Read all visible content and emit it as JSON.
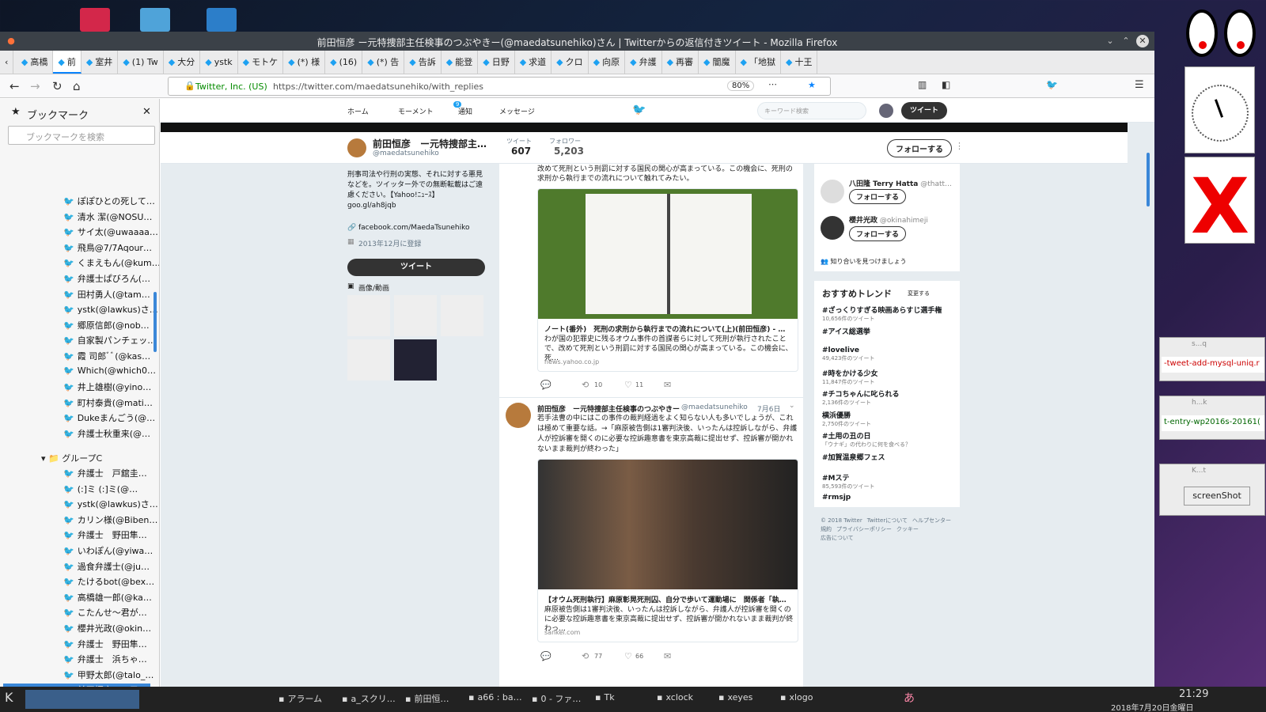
{
  "window": {
    "title": "前田恒彦 ー元特捜部主任検事のつぶやきー(@maedatsunehiko)さん | Twitterからの返信付きツイート - Mozilla Firefox"
  },
  "tabs": [
    "高橋",
    "前",
    "室井",
    "(1) Tw",
    "大分",
    "ystk",
    "モトケ",
    "(*) 様",
    "(16)",
    "(*) 告",
    "告訴",
    "能登",
    "日野",
    "求道",
    "クロ",
    "向原",
    "弁護",
    "再審",
    "闇魔",
    "「地獄",
    "十王"
  ],
  "nav": {
    "site_identity": "Twitter, Inc. (US)",
    "url": "https://twitter.com/maedatsunehiko/with_replies",
    "zoom": "80%"
  },
  "sidebar": {
    "title": "ブックマーク",
    "search_placeholder": "ブックマークを検索",
    "group": "グループC",
    "items_top": [
      "ぽぽひとの死して…",
      "清水 潔(@NOSU…",
      "サイ太(@uwaaaa…",
      "飛鳥@7/7Aqour…",
      "くまえもん(@kum…",
      "弁護士ぱびろん(…",
      "田村勇人(@tam…",
      "ystk(@lawkus)さ…",
      "郷原信郎(@nob…",
      "自家製パンチェッ…",
      "霞 司郎ﾞﾞ(@kas…",
      "Which(@which0…",
      "井上雄樹(@yino…",
      "町村泰貴(@mati…",
      "Dukeまんごう(@…",
      "弁護士秋重来(@…"
    ],
    "items_bottom": [
      "弁護士　戸舘圭…",
      "(:]ミ (:]ミ(@…",
      "ystk(@lawkus)さ…",
      "カリン様(@Biben…",
      "弁護士　野田隼…",
      "いわぽん(@yiwa…",
      "過食弁護士(@ju…",
      "たけるbot(@bex…",
      "高橋雄一郎(@ka…",
      "こたんせ～君が…",
      "櫻井光政(@okin…",
      "弁護士　野田隼…",
      "弁護士　浜ちゃ…",
      "甲野太郎(@talo_…",
      "前田恒彦　ー元…",
      "弁護士 市川 寛(…"
    ]
  },
  "twitter": {
    "nav": {
      "home": "ホーム",
      "moments": "モーメント",
      "notifications": "通知",
      "messages": "メッセージ",
      "search_placeholder": "キーワード検索",
      "tweet_button": "ツイート",
      "notif_count": "9"
    },
    "profile": {
      "name": "前田恒彦　ー元特捜部主…",
      "handle": "@maedatsunehiko",
      "tweets_label": "ツイート",
      "tweets": "607",
      "followers_label": "フォロワー",
      "followers": "5,203",
      "follow_button": "フォローする",
      "bio": "刑事司法や行刑の実態、それに対する悪見などを。ツイッター外での無断転載はご遠慮ください。【Yahoo!ﾆｭｰｽ】goo.gl/ah8jqb",
      "link": "facebook.com/MaedaTsunehiko",
      "joined": "2013年12月に登録",
      "tweet_button": "ツイート",
      "media_label": "画像/動画"
    },
    "tweet1": {
      "text_cont": "改めて死刑という刑罰に対する国民の関心が高まっている。この機会に、死刑の求刑から執行までの流れについて触れてみたい。",
      "card_title": "ノート(番外)　死刑の求刑から執行までの流れについて(上)(前田恒彦) - …",
      "card_desc": "わが国の犯罪史に残るオウム事件の首謀者らに対して死刑が執行されたことで、改めて死刑という刑罰に対する国民の関心が高まっている。この機会に、死…",
      "card_domain": "news.yahoo.co.jp",
      "retweets": "10",
      "likes": "11"
    },
    "tweet2": {
      "name": "前田恒彦　ー元特捜部主任検事のつぶやきー",
      "handle": "@maedatsunehiko",
      "date": "7月6日",
      "text": "若手法曹の中にはこの事件の裁判経過をよく知らない人も多いでしょうが、これは極めて重要な話。→「麻原被告側は1審判決後、いったんは控訴しながら、弁護人が控訴審を開くのに必要な控訴趣意書を東京高裁に提出せず、控訴審が開かれないまま裁判が終わった」",
      "card_title": "【オウム死刑執行】麻原彰晃死刑囚、自分で歩いて運動場に　関係者「執…",
      "card_desc": "麻原被告側は1審判決後、いったんは控訴しながら、弁護人が控訴審を開くのに必要な控訴趣意書を東京高裁に提出せず、控訴審が開かれないまま裁判が終わっ…",
      "card_domain": "sankei.com",
      "retweets": "77",
      "likes": "66"
    },
    "who_to_follow": [
      {
        "name": "八田隆 Terry Hatta",
        "handle": "@thatt…",
        "button": "フォローする"
      },
      {
        "name": "櫻井光政",
        "handle": "@okinahimeji",
        "button": "フォローする"
      }
    ],
    "find_friends": "知り合いを見つけましょう",
    "trends_title": "おすすめトレンド",
    "trends_change": "変更する",
    "trends": [
      {
        "tag": "#ざっくりすぎる映画あらすじ選手権",
        "count": "10,656件のツイート"
      },
      {
        "tag": "#アイス総選挙",
        "count": ""
      },
      {
        "tag": "#lovelive",
        "count": "49,423件のツイート"
      },
      {
        "tag": "#時をかける少女",
        "count": "11,847件のツイート"
      },
      {
        "tag": "#チコちゃんに叱られる",
        "count": "2,136件のツイート"
      },
      {
        "tag": "横浜優勝",
        "count": "2,750件のツイート"
      },
      {
        "tag": "#土用の丑の日",
        "count": "「ウナギ」の代わりに何を食べる？"
      },
      {
        "tag": "#加賀温泉郷フェス",
        "count": ""
      },
      {
        "tag": "#Mステ",
        "count": "85,593件のツイート"
      },
      {
        "tag": "#rmsjp",
        "count": ""
      }
    ],
    "footer": [
      "© 2018 Twitter",
      "Twitterについて",
      "ヘルプセンター",
      "規約",
      "プライバシーポリシー",
      "クッキー",
      "広告について"
    ]
  },
  "right_windows": {
    "w1": "-tweet-add-mysql-uniq.r",
    "w2": "t-entry-wp2016s-20161(",
    "w3_button": "screenShot",
    "w1_title": "s...q",
    "w2_title": "h...k",
    "w3_title": "K...t"
  },
  "taskbar": {
    "items": [
      "アラーム",
      "a_スクリ…",
      "前田恒…",
      "a66 : ba…",
      "0 - ファ…",
      "Tk",
      "xclock",
      "xeyes",
      "xlogo"
    ],
    "ime": "あ",
    "time": "21:29",
    "date": "2018年7月20日金曜日"
  },
  "colors": {
    "twitter_blue": "#1da1f2",
    "accent": "#0a84ff"
  }
}
